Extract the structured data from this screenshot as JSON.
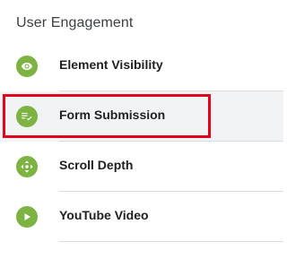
{
  "section": {
    "title": "User Engagement"
  },
  "items": [
    {
      "label": "Element Visibility",
      "icon": "eye-icon",
      "color": "#7cb342",
      "selected": false
    },
    {
      "label": "Form Submission",
      "icon": "form-submit-icon",
      "color": "#7cb342",
      "selected": true
    },
    {
      "label": "Scroll Depth",
      "icon": "scroll-arrows-icon",
      "color": "#7cb342",
      "selected": false
    },
    {
      "label": "YouTube Video",
      "icon": "play-icon",
      "color": "#7cb342",
      "selected": false
    }
  ],
  "colors": {
    "icon_green": "#7cb342",
    "highlight_red": "#e3001b",
    "selected_bg": "#f1f3f4",
    "divider": "#dadce0"
  }
}
